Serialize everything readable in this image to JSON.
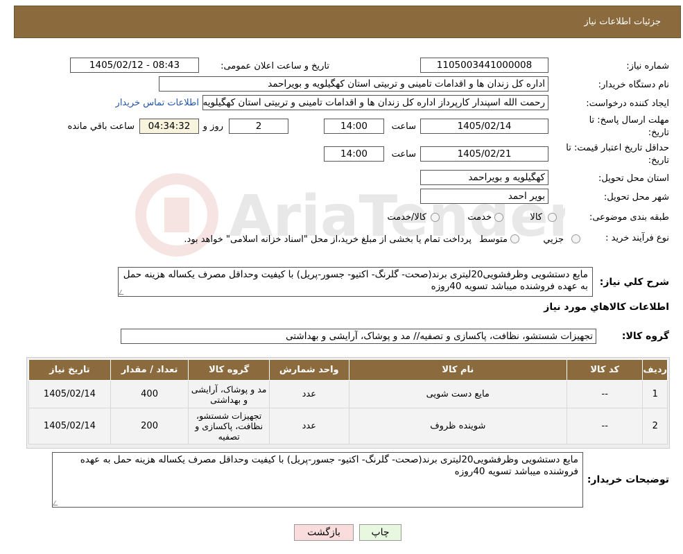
{
  "header": {
    "title": "جزئیات اطلاعات نیاز"
  },
  "form": {
    "need_number_label": "شماره نیاز:",
    "need_number": "1105003441000008",
    "announce_label": "تاریخ و ساعت اعلان عمومی:",
    "announce_value": "1405/02/12 - 08:43",
    "buyer_org_label": "نام دستگاه خریدار:",
    "buyer_org": "اداره کل زندان ها و اقدامات تامینی و تربیتی استان کهگیلویه و بویراحمد",
    "creator_label": "ایجاد کننده درخواست:",
    "creator": "رحمت الله اسپندار کارپرداز اداره کل زندان ها و اقدامات تامینی و تربیتی استان کهگیلویه و بویراحمد",
    "contact_link": "اطلاعات تماس خریدار",
    "deadline_label_1": "مهلت ارسال پاسخ: تا",
    "deadline_label_2": "تاریخ:",
    "deadline_date": "1405/02/14",
    "time_label": "ساعت",
    "deadline_time": "14:00",
    "days_value": "2",
    "days_label": "روز و",
    "remaining_time": "04:34:32",
    "remaining_label": "ساعت باقي مانده",
    "validity_label_1": "حداقل تاريخ اعتبار قيمت: تا",
    "validity_label_2": "تاریخ:",
    "validity_date": "1405/02/21",
    "validity_time": "14:00",
    "province_label": "استان محل تحویل:",
    "province": "کهگیلویه و بویراحمد",
    "city_label": "شهر محل تحویل:",
    "city": "بویر احمد",
    "category_label": "طبقه بندی موضوعی:",
    "category_options": [
      "کالا",
      "خدمت",
      "کالا/خدمت"
    ],
    "process_label": "نوع فرآیند خرید :",
    "process_options": [
      "جزیي",
      "متوسط"
    ],
    "process_note": "پرداخت تمام یا بخشی از مبلغ خرید،از محل \"اسناد خزانه اسلامی\" خواهد بود."
  },
  "summary": {
    "label": "شرح کلي نياز:",
    "text": "مایع دستشویی وظرفشویی20لیتری برند(صحت- گلرنگ- اکتیو- جسور-پریل) با کیفیت وحداقل مصرف یکساله هزینه حمل به عهده فروشنده میباشد تسویه 40روزه"
  },
  "goods": {
    "section_title": "اطلاعات کالاهاي مورد نياز",
    "group_label": "گروه کالا:",
    "group_value": "تجهیزات شستشو، نظافت، پاکسازی و تصفیه// مد و پوشاک، آرایشی و بهداشتی"
  },
  "table": {
    "headers": [
      "ردیف",
      "کد کالا",
      "نام کالا",
      "واحد شمارش",
      "گروه کالا",
      "تعداد / مقدار",
      "تاریخ نیاز"
    ],
    "rows": [
      [
        "1",
        "--",
        "مایع دست شویی",
        "عدد",
        "مد و پوشاک، آرایشی و بهداشتی",
        "400",
        "1405/02/14"
      ],
      [
        "2",
        "--",
        "شوینده ظروف",
        "عدد",
        "تجهیزات شستشو، نظافت، پاکسازی و تصفیه",
        "200",
        "1405/02/14"
      ]
    ]
  },
  "buyer_notes": {
    "label": "توضیحات خریدار:",
    "text": "مایع دستشویی وظرفشویی20لیتری برند(صحت- گلرنگ- اکتیو- جسور-پریل) با کیفیت وحداقل مصرف یکساله هزینه حمل به عهده فروشنده میباشد تسویه 40روزه"
  },
  "buttons": {
    "print": "چاپ",
    "back": "بازگشت"
  },
  "colors": {
    "header_bg": "#8b6b3e",
    "print_bg": "#e8f7e0",
    "back_bg": "#f9dcdc",
    "link": "#2255aa"
  },
  "watermark": {
    "brand": "AriaTender.neT"
  }
}
